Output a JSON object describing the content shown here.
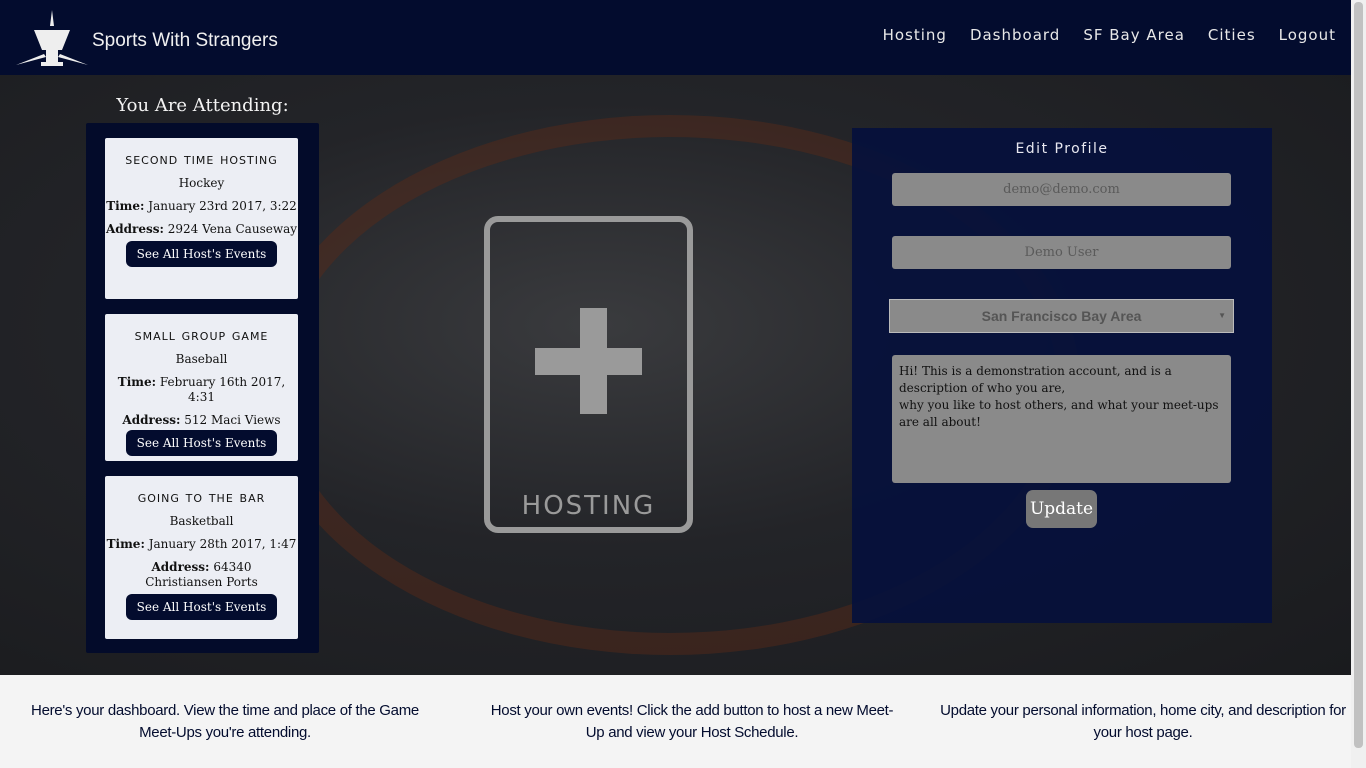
{
  "nav": {
    "brand": "Sports With Strangers",
    "items": [
      "Hosting",
      "Dashboard",
      "SF Bay Area",
      "Cities",
      "Logout"
    ]
  },
  "attending": {
    "title": "You Are Attending:",
    "time_label": "Time:",
    "address_label": "Address:",
    "events": [
      {
        "title": "Second Time Hosting",
        "sport": "Hockey",
        "time": "January 23rd 2017, 3:22",
        "address": "2924 Vena Causeway",
        "button": "See All Host's Events"
      },
      {
        "title": "Small Group Game",
        "sport": "Baseball",
        "time": "February 16th 2017, 4:31",
        "address": "512 Maci Views",
        "button": "See All Host's Events"
      },
      {
        "title": "Going to the Bar",
        "sport": "Basketball",
        "time": "January 28th 2017, 1:47",
        "address": "64340 Christiansen Ports",
        "button": "See All Host's Events"
      }
    ]
  },
  "hosting": {
    "label": "HOSTING"
  },
  "profile": {
    "title": "Edit Profile",
    "email": "demo@demo.com",
    "name": "Demo User",
    "city": "San Francisco Bay Area",
    "description": "Hi! This is a demonstration account, and is a description of who you are,\nwhy you like to host others, and what your meet-ups are all about!",
    "update": "Update"
  },
  "footer": [
    "Here's your dashboard. View the time and place of the Game Meet-Ups you're attending.",
    "Host your own events! Click the add button to host a new Meet-Up and view your Host Schedule.",
    "Update your personal information, home city, and description for your host page."
  ]
}
